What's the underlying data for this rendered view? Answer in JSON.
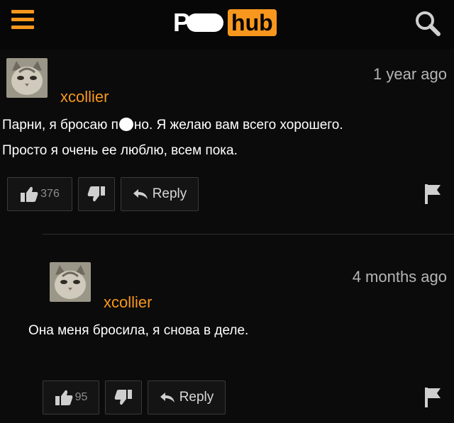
{
  "header": {
    "logo_left": "P",
    "logo_right": "hub",
    "menu_icon": "hamburger-menu-icon",
    "search_icon": "search-icon",
    "accent_color": "#f7971d"
  },
  "comments": [
    {
      "username": "xcollier",
      "time": "1 year ago",
      "line1_before": "Парни, я бросаю п",
      "line1_after": "но. Я желаю вам всего хорошего.",
      "line2": "Просто я очень ее люблю, всем пока.",
      "likes": "376",
      "reply_label": "Reply"
    },
    {
      "username": "xcollier",
      "time": "4 months ago",
      "line1": "Она меня бросила, я снова в деле.",
      "likes": "95",
      "reply_label": "Reply"
    }
  ]
}
